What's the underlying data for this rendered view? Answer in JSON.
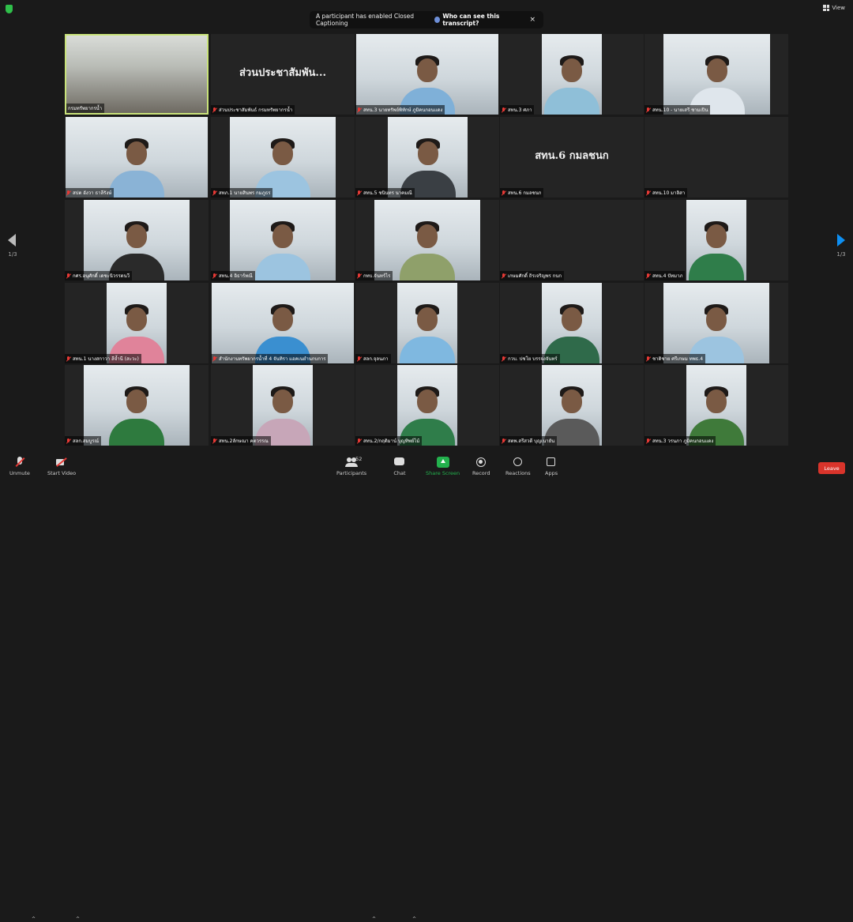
{
  "banner": {
    "text": "A participant has enabled Closed Captioning",
    "link": "Who can see this transcript?",
    "close": "×"
  },
  "top": {
    "view_label": "View"
  },
  "pager": {
    "left": "1/3",
    "right": "1/3"
  },
  "tiles": [
    {
      "name": "กรมทรัพยากรน้ำ",
      "muted": false,
      "active": true,
      "video": "room"
    },
    {
      "name": "ส่วนประชาสัมพันธ์ กรมทรัพยากรน้ำ",
      "big": "ส่วนประชาสัมพัน...",
      "muted": true
    },
    {
      "name": "สทน.3 นายทรัพย์พิทักษ์ ภูมิคนกอนแดง",
      "muted": true,
      "video": "person",
      "color": "#7fb0d8"
    },
    {
      "name": "สทน.3 ศภา",
      "muted": true,
      "video": "person",
      "color": "#8fbfd8"
    },
    {
      "name": "สทน.10 - นายเสรี ชามเปิน",
      "muted": true,
      "video": "person",
      "color": "#dfe6ec"
    },
    {
      "name": "สปต อังวา ธาลีรังษ์",
      "muted": true,
      "video": "person",
      "color": "#8ab3d6"
    },
    {
      "name": "สทภ.1 นายสินพร กมภูธร",
      "muted": true,
      "video": "person",
      "color": "#9cc4e0"
    },
    {
      "name": "สทน.5 ชนินทร นาคมณี",
      "muted": true,
      "video": "person",
      "color": "#3a3f44"
    },
    {
      "name": "สทน.6 กมลชนก",
      "big": "สทน.6 กมลชนก",
      "muted": true
    },
    {
      "name": "สทน.10 มาลิสา",
      "muted": true
    },
    {
      "name": "กศร.อนุศักดิ์ เดชะนิวรรตนวี",
      "muted": true,
      "video": "person",
      "color": "#2a2a2a"
    },
    {
      "name": "สทน.4 อิธาร์ทณี",
      "muted": true,
      "video": "person",
      "color": "#9cc4e0"
    },
    {
      "name": "กทบ.จันทร์ไร",
      "muted": true,
      "video": "person",
      "color": "#8fa06a"
    },
    {
      "name": "เกษมศักดิ์ ถิรเจริญพร กนก",
      "muted": true
    },
    {
      "name": "สทน.4 ปัทมาภ",
      "muted": true,
      "video": "person",
      "color": "#2f7d4a"
    },
    {
      "name": "สทน.1 นางสกาวา ลีจ้ำนี (สะวะ)",
      "muted": true,
      "video": "person",
      "color": "#e0839a"
    },
    {
      "name": "สำนักงานทรัพยากรน้ำที่ 4 จันทิรา แอคเนยำนกบการ",
      "muted": true,
      "video": "person",
      "color": "#3a8fd0"
    },
    {
      "name": "สลก.จุลนภา",
      "muted": true,
      "video": "person",
      "color": "#7fb8e0"
    },
    {
      "name": "กวบ. ปชโย บรรจงจันทร์",
      "muted": true,
      "video": "person",
      "color": "#2f6a4a"
    },
    {
      "name": "ชาติชาย ศรีเกษม ทพธ.4",
      "muted": true,
      "video": "person",
      "color": "#9cc4e0"
    },
    {
      "name": "สลก.สมบูรณ์",
      "muted": true,
      "video": "person",
      "color": "#2e7a3e"
    },
    {
      "name": "สทน.2ลักษณา คตวรรณ",
      "muted": true,
      "video": "person",
      "color": "#c7a6b8"
    },
    {
      "name": "สทน.2/กฤติมาน์ บุญทิพย์ไม้",
      "muted": true,
      "video": "person",
      "color": "#2f7d4a"
    },
    {
      "name": "สตพ.สรีสวดี บุญเนายัน",
      "muted": true,
      "video": "person",
      "color": "#5a5a5a"
    },
    {
      "name": "สทน.3 วรนภา ภูมิคนกอนแดง",
      "muted": true,
      "video": "person",
      "color": "#3f7a3a"
    }
  ],
  "toolbar": {
    "unmute": "Unmute",
    "start_video": "Start Video",
    "participants": "Participants",
    "participants_count": "52",
    "chat": "Chat",
    "share_screen": "Share Screen",
    "record": "Record",
    "reactions": "Reactions",
    "apps": "Apps",
    "leave": "Leave"
  },
  "colors": {
    "share": "#23b14d",
    "leave": "#d9342b",
    "active_border": "#c9e37a",
    "next_arrow": "#0e8ff2"
  }
}
